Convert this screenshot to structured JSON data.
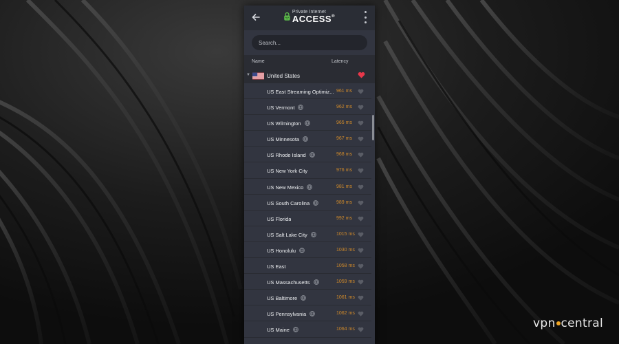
{
  "app": {
    "logo_small": "Private Internet",
    "logo_big": "ACCESS",
    "logo_mark": "®"
  },
  "search": {
    "placeholder": "Search..."
  },
  "columns": {
    "name": "Name",
    "latency": "Latency"
  },
  "country": {
    "name": "United States",
    "favorite": true,
    "favorite_color": "#e8374a"
  },
  "servers": [
    {
      "name": "US East Streaming Optimiz...",
      "latency": "961 ms",
      "geo": false
    },
    {
      "name": "US Vermont",
      "latency": "962 ms",
      "geo": true
    },
    {
      "name": "US Wilmington",
      "latency": "965 ms",
      "geo": true
    },
    {
      "name": "US Minnesota",
      "latency": "967 ms",
      "geo": true
    },
    {
      "name": "US Rhode Island",
      "latency": "968 ms",
      "geo": true
    },
    {
      "name": "US New York City",
      "latency": "976 ms",
      "geo": false
    },
    {
      "name": "US New Mexico",
      "latency": "981 ms",
      "geo": true
    },
    {
      "name": "US South Carolina",
      "latency": "989 ms",
      "geo": true
    },
    {
      "name": "US Florida",
      "latency": "992 ms",
      "geo": false
    },
    {
      "name": "US Salt Lake City",
      "latency": "1015 ms",
      "geo": true
    },
    {
      "name": "US Honolulu",
      "latency": "1030 ms",
      "geo": true
    },
    {
      "name": "US East",
      "latency": "1058 ms",
      "geo": false
    },
    {
      "name": "US Massachusetts",
      "latency": "1059 ms",
      "geo": true
    },
    {
      "name": "US Baltimore",
      "latency": "1061 ms",
      "geo": true
    },
    {
      "name": "US Pennsylvania",
      "latency": "1062 ms",
      "geo": true
    },
    {
      "name": "US Maine",
      "latency": "1064 ms",
      "geo": true
    }
  ],
  "colors": {
    "latency": "#d08a2a",
    "panel": "#323540",
    "accent_green": "#5bb84a"
  },
  "watermark": {
    "part1": "vpn",
    "part2": "central"
  }
}
